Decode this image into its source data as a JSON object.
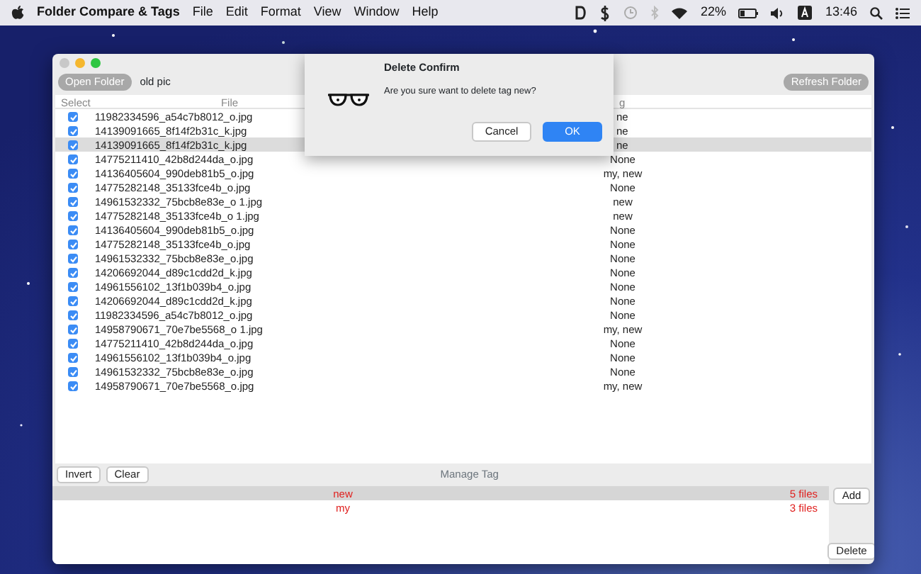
{
  "menu_bar": {
    "app_name": "Folder Compare & Tags",
    "menus": [
      "File",
      "Edit",
      "Format",
      "View",
      "Window",
      "Help"
    ],
    "battery_text": "22%",
    "clock": "13:46"
  },
  "toolbar": {
    "open_button": "Open Folder",
    "folder_name": "old pic",
    "refresh_button": "Refresh Folder"
  },
  "table": {
    "columns": [
      "Select",
      "File",
      "g"
    ],
    "rows": [
      {
        "file": "11982334596_a54c7b8012_o.jpg",
        "tag": "ne",
        "clipped": true,
        "checked": true,
        "selected": false
      },
      {
        "file": "14139091665_8f14f2b31c_k.jpg",
        "tag": "ne",
        "clipped": true,
        "checked": true,
        "selected": false
      },
      {
        "file": "14139091665_8f14f2b31c_k.jpg",
        "tag": "ne",
        "clipped": true,
        "checked": true,
        "selected": true
      },
      {
        "file": "14775211410_42b8d244da_o.jpg",
        "tag": "None",
        "clipped": false,
        "checked": true,
        "selected": false
      },
      {
        "file": "14136405604_990deb81b5_o.jpg",
        "tag": "my, new",
        "clipped": false,
        "checked": true,
        "selected": false
      },
      {
        "file": "14775282148_35133fce4b_o.jpg",
        "tag": "None",
        "clipped": false,
        "checked": true,
        "selected": false
      },
      {
        "file": "14961532332_75bcb8e83e_o 1.jpg",
        "tag": "new",
        "clipped": false,
        "checked": true,
        "selected": false
      },
      {
        "file": "14775282148_35133fce4b_o 1.jpg",
        "tag": "new",
        "clipped": false,
        "checked": true,
        "selected": false
      },
      {
        "file": "14136405604_990deb81b5_o.jpg",
        "tag": "None",
        "clipped": false,
        "checked": true,
        "selected": false
      },
      {
        "file": "14775282148_35133fce4b_o.jpg",
        "tag": "None",
        "clipped": false,
        "checked": true,
        "selected": false
      },
      {
        "file": "14961532332_75bcb8e83e_o.jpg",
        "tag": "None",
        "clipped": false,
        "checked": true,
        "selected": false
      },
      {
        "file": "14206692044_d89c1cdd2d_k.jpg",
        "tag": "None",
        "clipped": false,
        "checked": true,
        "selected": false
      },
      {
        "file": "14961556102_13f1b039b4_o.jpg",
        "tag": "None",
        "clipped": false,
        "checked": true,
        "selected": false
      },
      {
        "file": "14206692044_d89c1cdd2d_k.jpg",
        "tag": "None",
        "clipped": false,
        "checked": true,
        "selected": false
      },
      {
        "file": "11982334596_a54c7b8012_o.jpg",
        "tag": "None",
        "clipped": false,
        "checked": true,
        "selected": false
      },
      {
        "file": "14958790671_70e7be5568_o 1.jpg",
        "tag": "my, new",
        "clipped": false,
        "checked": true,
        "selected": false
      },
      {
        "file": "14775211410_42b8d244da_o.jpg",
        "tag": "None",
        "clipped": false,
        "checked": true,
        "selected": false
      },
      {
        "file": "14961556102_13f1b039b4_o.jpg",
        "tag": "None",
        "clipped": false,
        "checked": true,
        "selected": false
      },
      {
        "file": "14961532332_75bcb8e83e_o.jpg",
        "tag": "None",
        "clipped": false,
        "checked": true,
        "selected": false
      },
      {
        "file": "14958790671_70e7be5568_o.jpg",
        "tag": "my, new",
        "clipped": false,
        "checked": true,
        "selected": false
      }
    ]
  },
  "bottom_bar": {
    "buttons": [
      "Invert",
      "Clear"
    ],
    "title": "Manage Tag"
  },
  "tags": [
    {
      "name": "new",
      "count": "5 files",
      "selected": true
    },
    {
      "name": "my",
      "count": "3 files",
      "selected": false
    }
  ],
  "add_button": "Add",
  "delete_button": "Delete",
  "dialog": {
    "title": "Delete Confirm",
    "message": "Are you sure want to delete tag new?",
    "buttons": [
      {
        "label": "Cancel",
        "kind": "default"
      },
      {
        "label": "OK",
        "kind": "primary"
      }
    ]
  }
}
